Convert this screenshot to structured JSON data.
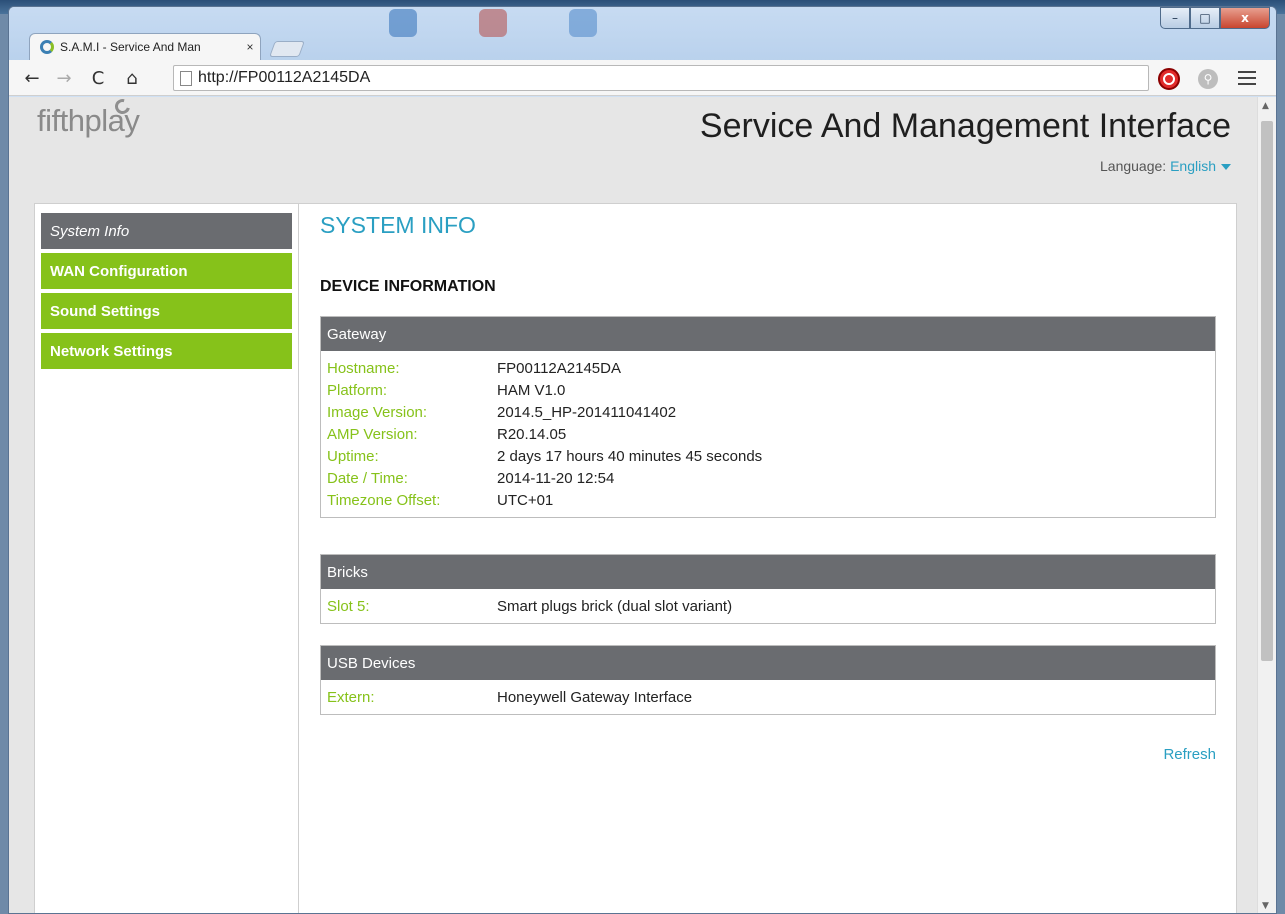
{
  "browser": {
    "tab_title": "S.A.M.I - Service And Man",
    "tab_close": "×",
    "url": "http://FP00112A2145DA",
    "window_min": "–",
    "window_max": "□",
    "window_close": "x"
  },
  "header": {
    "logo_text": "fifthplay",
    "title": "Service And Management Interface",
    "language_label": "Language:",
    "language_value": "English"
  },
  "sidebar": {
    "items": [
      {
        "label": "System Info",
        "active": true
      },
      {
        "label": "WAN Configuration",
        "active": false
      },
      {
        "label": "Sound Settings",
        "active": false
      },
      {
        "label": "Network Settings",
        "active": false
      }
    ]
  },
  "main": {
    "section_title": "SYSTEM INFO",
    "subsection_title": "DEVICE INFORMATION",
    "gateway": {
      "title": "Gateway",
      "rows": [
        {
          "key": "Hostname:",
          "value": "FP00112A2145DA"
        },
        {
          "key": "Platform:",
          "value": "HAM V1.0"
        },
        {
          "key": "Image Version:",
          "value": "2014.5_HP-201411041402"
        },
        {
          "key": "AMP Version:",
          "value": "R20.14.05"
        },
        {
          "key": "Uptime:",
          "value": "2 days 17 hours 40 minutes 45 seconds"
        },
        {
          "key": "Date / Time:",
          "value": "2014-11-20 12:54"
        },
        {
          "key": "Timezone Offset:",
          "value": "UTC+01"
        }
      ]
    },
    "bricks": {
      "title": "Bricks",
      "rows": [
        {
          "key": "Slot 5:",
          "value": "Smart plugs brick (dual slot variant)"
        }
      ]
    },
    "usb": {
      "title": "USB Devices",
      "rows": [
        {
          "key": "Extern:",
          "value": "Honeywell Gateway Interface"
        }
      ]
    },
    "refresh_label": "Refresh"
  },
  "colors": {
    "accent_blue": "#2a9fc2",
    "accent_green": "#86c21a",
    "header_grey": "#6a6c70"
  }
}
